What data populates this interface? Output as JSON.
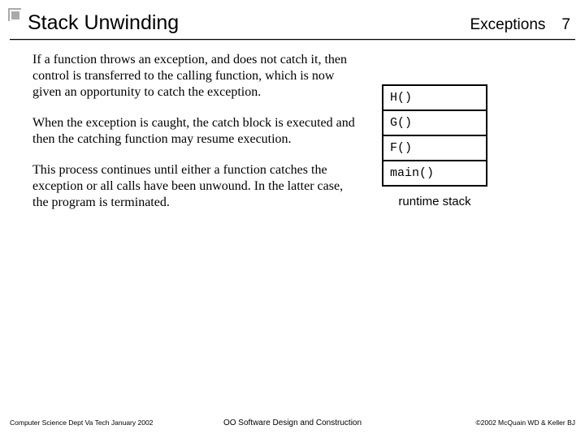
{
  "header": {
    "title": "Stack Unwinding",
    "topic": "Exceptions",
    "page": "7"
  },
  "paragraphs": {
    "p1": "If a function throws an exception, and does not catch it, then control is transferred to the calling function, which is now given an opportunity to catch the exception.",
    "p2": "When the exception is caught, the catch block is executed and then the catching function may resume execution.",
    "p3": "This process continues until either a function catches the exception or all calls have been unwound.  In the latter case, the program is terminated."
  },
  "stack": {
    "frames": {
      "f0": "H()",
      "f1": "G()",
      "f2": "F()",
      "f3": "main()"
    },
    "caption": "runtime stack"
  },
  "footer": {
    "left": "Computer Science Dept Va Tech January 2002",
    "center": "OO Software Design and Construction",
    "right": "©2002  McQuain WD & Keller BJ"
  }
}
